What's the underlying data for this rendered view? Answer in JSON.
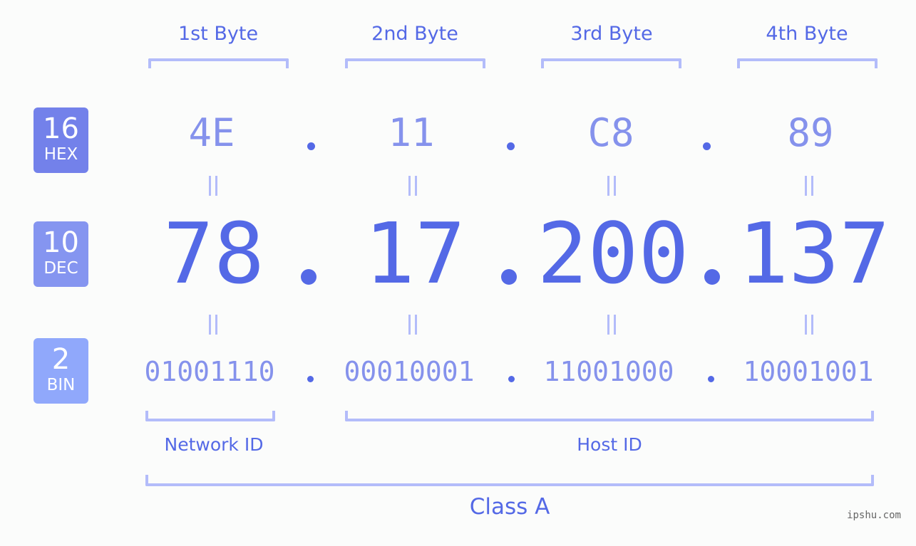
{
  "ip": {
    "bytes": [
      {
        "label": "1st Byte",
        "hex": "4E",
        "dec": "78",
        "bin": "01001110"
      },
      {
        "label": "2nd Byte",
        "hex": "11",
        "dec": "17",
        "bin": "00010001"
      },
      {
        "label": "3rd Byte",
        "hex": "C8",
        "dec": "200",
        "bin": "11001000"
      },
      {
        "label": "4th Byte",
        "hex": "89",
        "dec": "137",
        "bin": "10001001"
      }
    ],
    "separator": "."
  },
  "bases": {
    "hex": {
      "number": "16",
      "label": "HEX"
    },
    "dec": {
      "number": "10",
      "label": "DEC"
    },
    "bin": {
      "number": "2",
      "label": "BIN"
    }
  },
  "segments": {
    "network": "Network ID",
    "host": "Host ID",
    "class": "Class A"
  },
  "watermark": "ipshu.com",
  "colors": {
    "primary": "#5469e6",
    "secondary": "#8592ec",
    "bracket": "#b3bcfa",
    "badge_hex": "#7381ea",
    "badge_dec": "#8595f0",
    "badge_bin": "#90a8fb",
    "background": "#fbfcfb"
  }
}
